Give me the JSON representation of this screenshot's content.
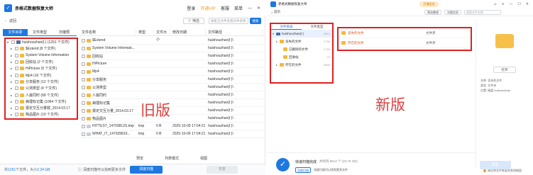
{
  "old": {
    "app_title": "赤格式数据恢复大师",
    "menu": [
      "登录",
      "开通VIP",
      "客服",
      "菜单"
    ],
    "back": "返回",
    "filter": "筛选",
    "search_placeholder": "搜索正文件名或文件名称",
    "search_btn": "搜索",
    "tabs": [
      "文件目录",
      "文件类型",
      "扫描预"
    ],
    "tree": [
      {
        "label": "huishouzhan(I:) (1261 个文件)",
        "level": 0,
        "icon": "drive"
      },
      {
        "label": "$Extend (8 个文件)",
        "level": 1,
        "icon": "folder"
      },
      {
        "label": "System Volume Information",
        "level": 1,
        "icon": "folder"
      },
      {
        "label": "回收站 (2 个文件)",
        "level": 1,
        "icon": "folder"
      },
      {
        "label": "HiPicture (5 个文件)",
        "level": 1,
        "icon": "folder"
      },
      {
        "label": "Mp4 (16 个文件)",
        "level": 1,
        "icon": "folder"
      },
      {
        "label": "分享服务 (12 个文件)",
        "level": 1,
        "icon": "folder"
      },
      {
        "label": "公测类型 (4 个文件)",
        "level": 1,
        "icon": "folder"
      },
      {
        "label": "人最同时 (68 个文件)",
        "level": 1,
        "icon": "folder"
      },
      {
        "label": "病理标记集 (1064 个文件)",
        "level": 1,
        "icon": "folder"
      },
      {
        "label": "报定交互分量罪_2014.03.17",
        "level": 1,
        "icon": "folder"
      },
      {
        "label": "物品图片 (19 个文件)",
        "level": 1,
        "icon": "folder"
      }
    ],
    "file_headers": [
      "文件名称",
      "类型",
      "文件大小",
      "修改日期",
      "文件路径"
    ],
    "files": [
      {
        "name": "$Extend",
        "type": "",
        "size": "",
        "date": "",
        "path": "huishouzhan(I:)\\"
      },
      {
        "name": "System Volume Informati...",
        "type": "",
        "size": "",
        "date": "",
        "path": "huishouzhan(I:)\\"
      },
      {
        "name": "回收站",
        "type": "",
        "size": "",
        "date": "",
        "path": "huishouzhan(I:)\\"
      },
      {
        "name": "HiPicture",
        "type": "",
        "size": "",
        "date": "",
        "path": "huishouzhan(I:)\\"
      },
      {
        "name": "Mp4",
        "type": "",
        "size": "",
        "date": "",
        "path": "huishouzhan(I:)\\"
      },
      {
        "name": "分享服务",
        "type": "",
        "size": "",
        "date": "",
        "path": "huishouzhan(I:)\\"
      },
      {
        "name": "公测类型",
        "type": "",
        "size": "",
        "date": "",
        "path": "huishouzhan(I:)\\"
      },
      {
        "name": "人最同时",
        "type": "",
        "size": "",
        "date": "",
        "path": "huishouzhan(I:)\\"
      },
      {
        "name": "病理标记集",
        "type": "",
        "size": "",
        "date": "",
        "path": "huishouzhan(I:)\\"
      },
      {
        "name": "报定交互分量_2014.03.17",
        "type": "",
        "size": "",
        "date": "",
        "path": "huishouzhan(I:)\\"
      },
      {
        "name": "物品图片",
        "type": "",
        "size": "",
        "date": "",
        "path": "huishouzhan(I:)\\"
      },
      {
        "name": "HITTEST_14703812S.tmp",
        "type": "tmp",
        "size": "0 B",
        "date": "2025-10-09 17:04:21",
        "path": "huishouzhan(I:)\\"
      },
      {
        "name": "WHAT_IT_147039810...",
        "type": "tmp",
        "size": "0 B",
        "date": "2025-10-09 17:04:21",
        "path": "huishouzhan(I:)\\"
      }
    ],
    "label_old": "旧版",
    "mid_left": "预览",
    "mid_mid": "列表模式",
    "mid_right": "视图",
    "status_prefix": "共",
    "status_count": "1261",
    "status_mid": "个文件，大小",
    "status_size": "2.24 GB",
    "deep_hint": "深度扫描可以找到更多文件",
    "deep_btn": "深度扫描",
    "recover_btn": "恢复"
  },
  "new": {
    "app_title": "赤格式数据恢复大师",
    "vip": "开通会员",
    "home": "首页",
    "filter": "筛选整理",
    "view": "详细信息",
    "search_placeholder": "搜索文件名称",
    "tabs": [
      "文件目录",
      "文件类型"
    ],
    "tree": [
      {
        "label": "huishouzhan(I:)",
        "count": "8614",
        "level": 0,
        "icon": "drive",
        "selected": true
      },
      {
        "label": "丢失的文件",
        "count": "2756",
        "level": 1,
        "icon": "folder",
        "selected": false
      },
      {
        "label": "已删除的文件",
        "count": "2733",
        "level": 2,
        "icon": "folder",
        "selected": false
      },
      {
        "label": "回收站",
        "count": "23",
        "level": 2,
        "icon": "folder",
        "selected": false
      },
      {
        "label": "存在的文件",
        "count": "5858",
        "level": 1,
        "icon": "folder",
        "selected": false
      }
    ],
    "files": [
      {
        "name": "丢失的文件",
        "type": "文件夹"
      },
      {
        "name": "存在的文件",
        "type": "文件夹"
      }
    ],
    "label_new": "新版",
    "open_btn": "打开",
    "meta_lines": [
      "名称: 丢失的文件",
      "类型: 文件夹",
      "位置: 磁盘 huishouzhan"
    ],
    "tip": "建议将文件恢复到其他磁盘",
    "done_title": "快速扫描完成",
    "done_sub": "共找到 8614 个 (23.76 GB)",
    "deep_btn": "深度扫描",
    "deep_hint": "深度扫描可以找到更多文件",
    "recover_btn": "恢复"
  }
}
